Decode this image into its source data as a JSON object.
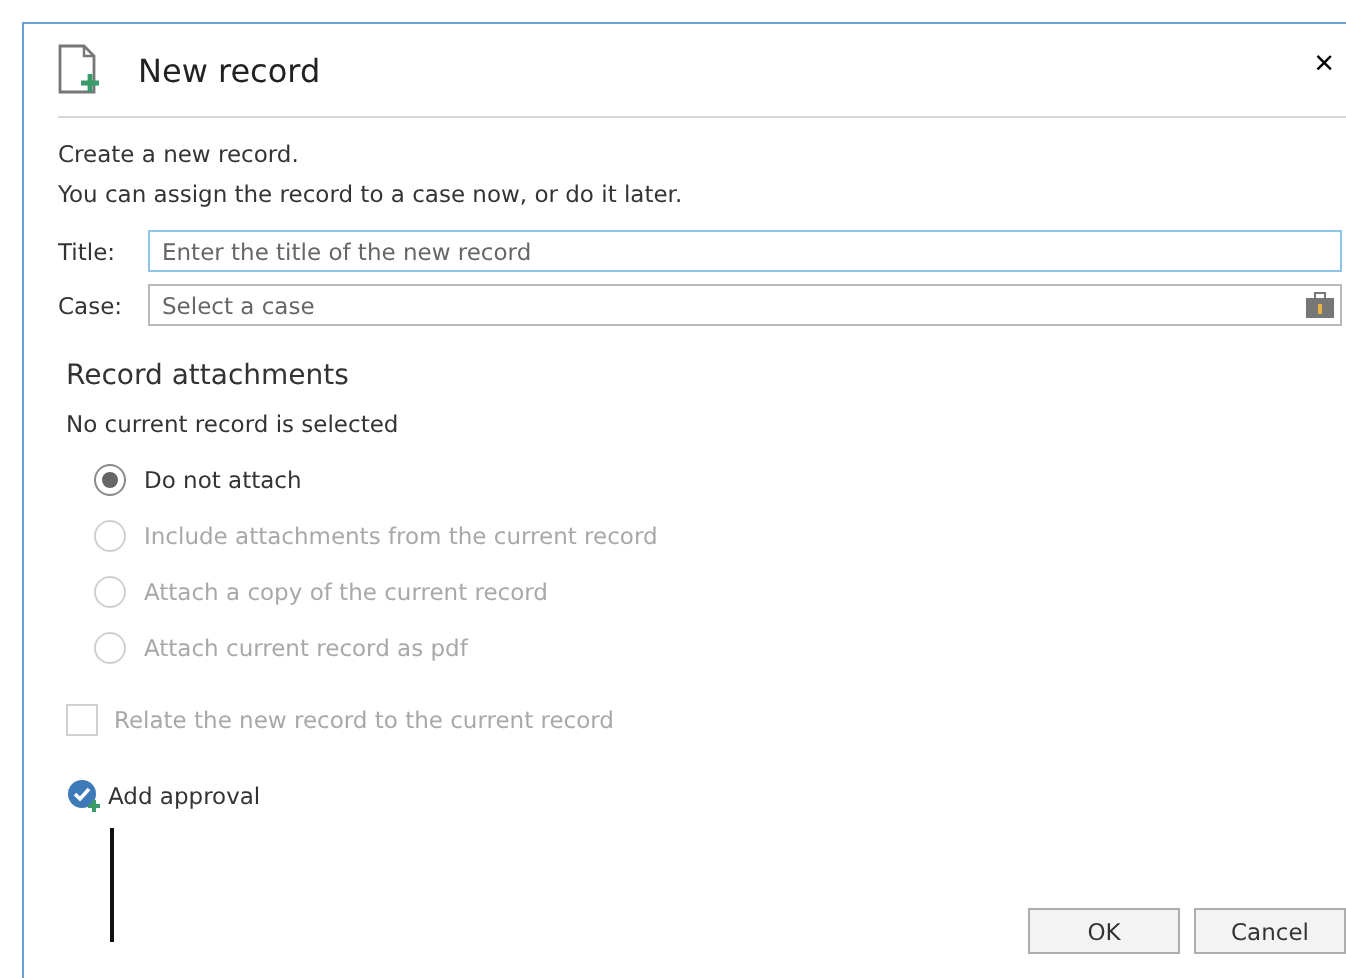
{
  "window": {
    "title": "New record",
    "close": "×"
  },
  "intro": [
    "Create a new record.",
    "You can assign the record to a case now, or do it later."
  ],
  "fields": [
    {
      "label": "Title:",
      "placeholder": "Enter the title of the new record",
      "focused": true,
      "kind": "text"
    },
    {
      "label": "Case:",
      "placeholder": "Select a case",
      "focused": false,
      "kind": "picker"
    }
  ],
  "attachments": {
    "heading": "Record attachments",
    "status": "No current record is selected",
    "options": [
      {
        "label": "Do not attach",
        "selected": true,
        "disabled": false
      },
      {
        "label": "Include attachments from the current record",
        "selected": false,
        "disabled": true
      },
      {
        "label": "Attach a copy of the current record",
        "selected": false,
        "disabled": true
      },
      {
        "label": "Attach current record as pdf",
        "selected": false,
        "disabled": true
      }
    ],
    "relate": {
      "label": "Relate the new record to the current record",
      "checked": false,
      "disabled": true
    }
  },
  "approval": {
    "label": "Add approval"
  },
  "buttons": [
    "OK",
    "Cancel"
  ]
}
